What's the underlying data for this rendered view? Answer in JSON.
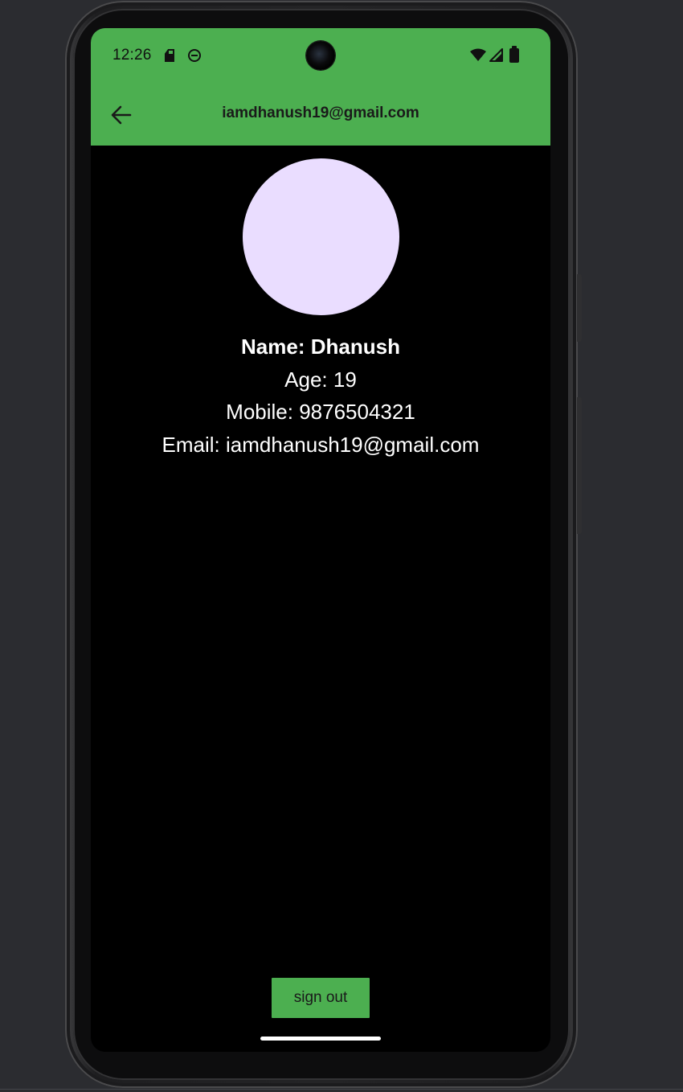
{
  "status_bar": {
    "time": "12:26",
    "icons": [
      "sd-card-icon",
      "android-debug-icon",
      "wifi-icon",
      "signal-icon",
      "battery-icon"
    ]
  },
  "app_bar": {
    "back_icon": "arrow-left-icon",
    "title": "iamdhanush19@gmail.com"
  },
  "profile": {
    "name_line": "Name: Dhanush",
    "age_line": "Age: 19",
    "mobile_line": "Mobile: 9876504321",
    "email_line": "Email: iamdhanush19@gmail.com"
  },
  "actions": {
    "sign_out_label": "sign out"
  },
  "colors": {
    "accent": "#4caf50",
    "avatar": "#eaddff",
    "screen_background": "#000000",
    "text_on_dark": "#ffffff"
  }
}
